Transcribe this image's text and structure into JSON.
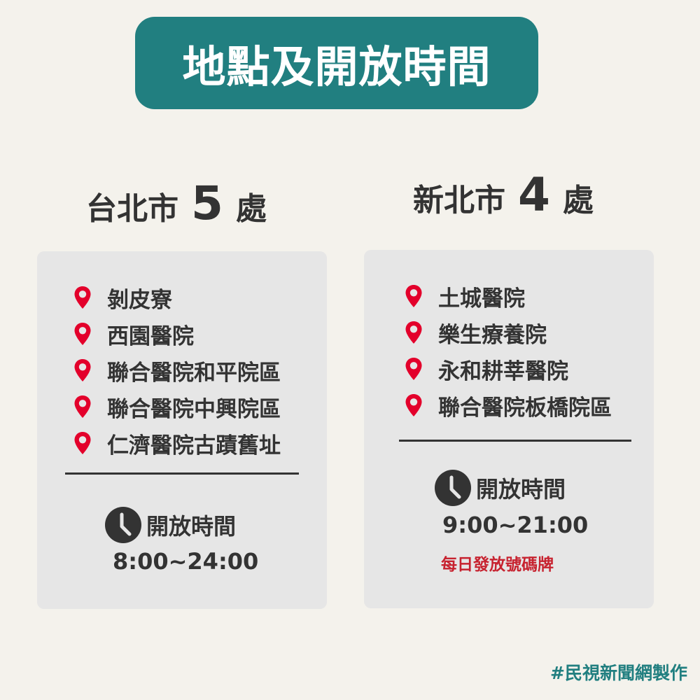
{
  "banner": {
    "title": "地點及開放時間"
  },
  "taipei": {
    "city": "台北市",
    "count": "5",
    "unit": "處",
    "locations": [
      "剝皮寮",
      "西園醫院",
      "聯合醫院和平院區",
      "聯合醫院中興院區",
      "仁濟醫院古蹟舊址"
    ],
    "hours_label": "開放時間",
    "hours": "8:00~24:00"
  },
  "newtaipei": {
    "city": "新北市",
    "count": "4",
    "unit": "處",
    "locations": [
      "土城醫院",
      "樂生療養院",
      "永和耕莘醫院",
      "聯合醫院板橋院區"
    ],
    "hours_label": "開放時間",
    "hours": "9:00~21:00",
    "note": "每日發放號碼牌"
  },
  "footer": {
    "credit": "#民視新聞網製作"
  },
  "icons": {
    "location": "map-pin-icon",
    "time": "clock-icon"
  },
  "colors": {
    "accent": "#217f80",
    "pin": "#e3002b",
    "note": "#c7222f",
    "background": "#f4f2ec",
    "card": "#e6e6e6"
  }
}
